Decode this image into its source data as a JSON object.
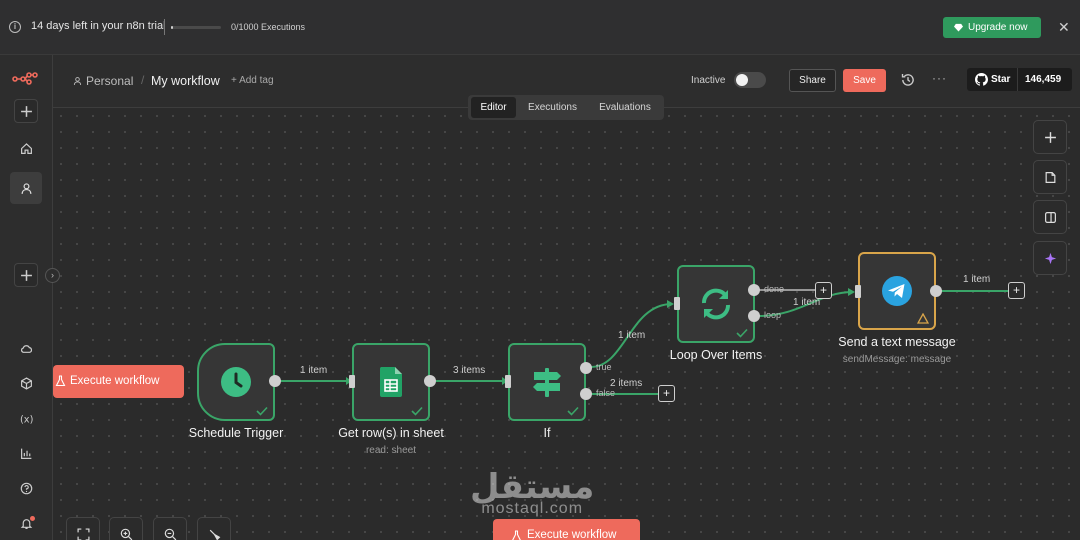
{
  "banner": {
    "trial_text": "14 days left in your n8n trial",
    "executions_text": "0/1000 Executions",
    "executions_progress": 0.02,
    "upgrade_label": "Upgrade now",
    "close_icon": "close-icon"
  },
  "header": {
    "project": "Personal",
    "workflow_title": "My workflow",
    "add_tag": "+ Add tag",
    "status_label": "Inactive",
    "share_label": "Share",
    "save_label": "Save",
    "github_star_label": "Star",
    "github_star_count": "146,459"
  },
  "tabs": [
    {
      "label": "Editor",
      "active": true
    },
    {
      "label": "Executions",
      "active": false
    },
    {
      "label": "Evaluations",
      "active": false
    }
  ],
  "nodes": {
    "schedule": {
      "label": "Schedule Trigger"
    },
    "sheet": {
      "label": "Get row(s) in sheet",
      "subtitle": "read: sheet"
    },
    "if": {
      "label": "If"
    },
    "loop": {
      "label": "Loop Over Items"
    },
    "telegram": {
      "label": "Send a text message",
      "subtitle": "sendMessage: message"
    }
  },
  "edges": {
    "schedule_to_sheet": "1 item",
    "sheet_to_if": "3 items",
    "if_true_to_loop": "1 item",
    "if_false": "2 items",
    "loop_to_telegram": "1 item",
    "telegram_out": "1 item"
  },
  "ports": {
    "if_true": "true",
    "if_false": "false",
    "loop_done": "done",
    "loop_loop": "loop"
  },
  "execute_label": "Execute workflow",
  "watermark": {
    "arabic": "مستقل",
    "latin": "mostaql.com"
  },
  "colors": {
    "accent": "#ee6a5c",
    "success": "#3aa568",
    "upgrade": "#2f9a5d",
    "warning": "#d9a54a"
  }
}
